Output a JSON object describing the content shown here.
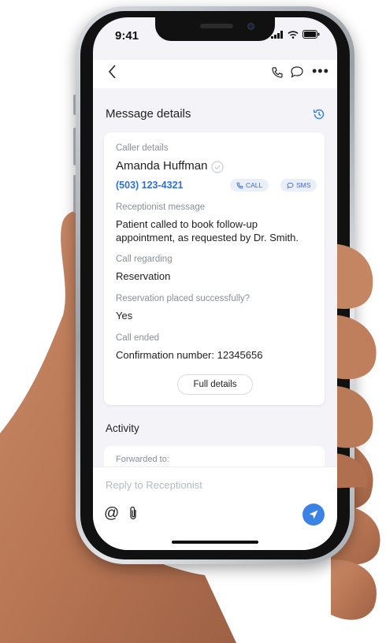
{
  "status_bar": {
    "time": "9:41"
  },
  "header": {
    "title": "Message details"
  },
  "caller": {
    "label": "Caller details",
    "name": "Amanda Huffman",
    "phone": "(503) 123-4321",
    "call_label": "CALL",
    "sms_label": "SMS"
  },
  "message": {
    "label": "Receptionist message",
    "text_line1": "Patient called to book follow-up",
    "text_line2": "appointment, as requested by Dr. Smith."
  },
  "regarding": {
    "label": "Call regarding",
    "value": "Reservation"
  },
  "reservation": {
    "label": "Reservation placed successfully?",
    "value": "Yes"
  },
  "ended": {
    "label": "Call ended",
    "value": "Confirmation number: 12345656"
  },
  "full_details_label": "Full details",
  "activity": {
    "title": "Activity",
    "forwarded_label": "Forwarded to:"
  },
  "composer": {
    "placeholder": "Reply to Receptionist",
    "at_symbol": "@"
  },
  "colors": {
    "accent": "#3b82e6",
    "link": "#2f6fd8",
    "background": "#f4f4f8"
  }
}
